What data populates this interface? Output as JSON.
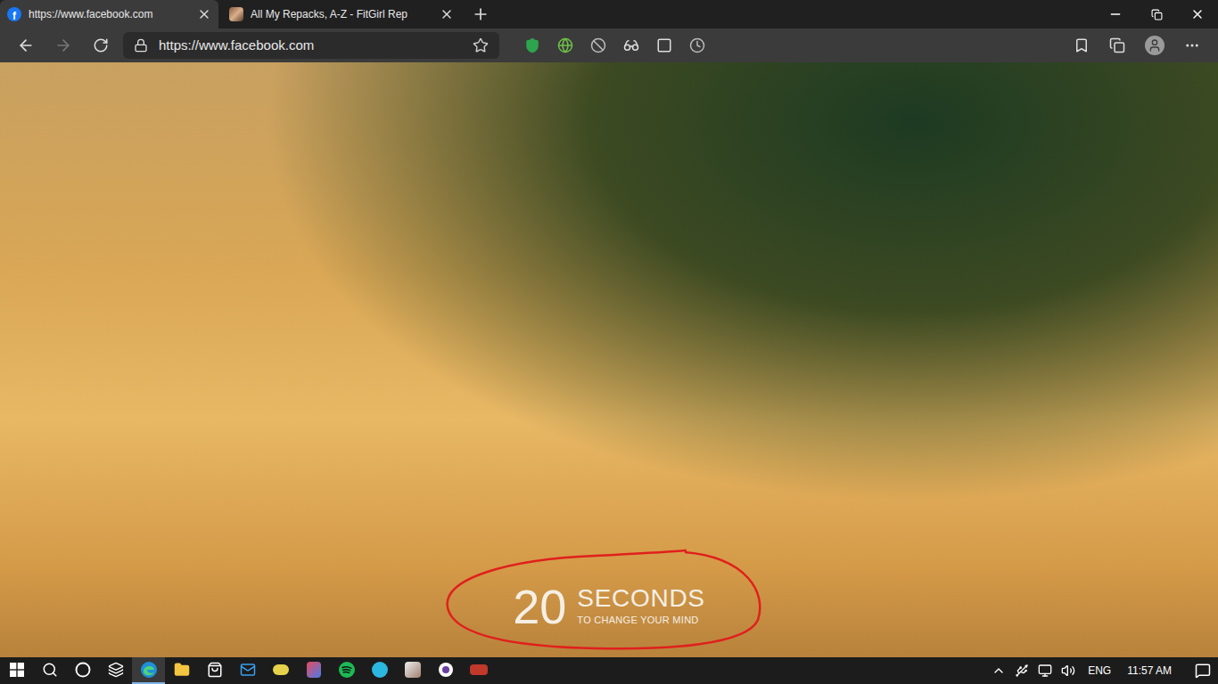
{
  "tabs": [
    {
      "label": "https://www.facebook.com",
      "favicon": "f",
      "selected": true
    },
    {
      "label": "All My Repacks, A-Z - FitGirl Rep",
      "favicon": "",
      "selected": false
    }
  ],
  "address_bar": {
    "url": "https://www.facebook.com"
  },
  "blocker": {
    "count": "20",
    "unit": "SECONDS",
    "caption": "TO CHANGE YOUR MIND",
    "annotated": true
  },
  "taskbar": {
    "apps": [
      {
        "kind": "start",
        "active": false
      },
      {
        "kind": "search",
        "active": false
      },
      {
        "kind": "cortana",
        "active": false
      },
      {
        "kind": "taskview",
        "active": false
      },
      {
        "kind": "edge",
        "active": true
      },
      {
        "kind": "explorer",
        "active": false
      },
      {
        "kind": "store",
        "active": false
      },
      {
        "kind": "mail",
        "active": false
      },
      {
        "kind": "yellow-app",
        "active": false
      },
      {
        "kind": "colorful-app",
        "active": false
      },
      {
        "kind": "spotify",
        "active": false
      },
      {
        "kind": "cyan-app",
        "active": false
      },
      {
        "kind": "photo-app",
        "active": false
      },
      {
        "kind": "disc-app",
        "active": false
      },
      {
        "kind": "red-app",
        "active": false
      }
    ],
    "language": "ENG",
    "time": "11:57 AM"
  }
}
